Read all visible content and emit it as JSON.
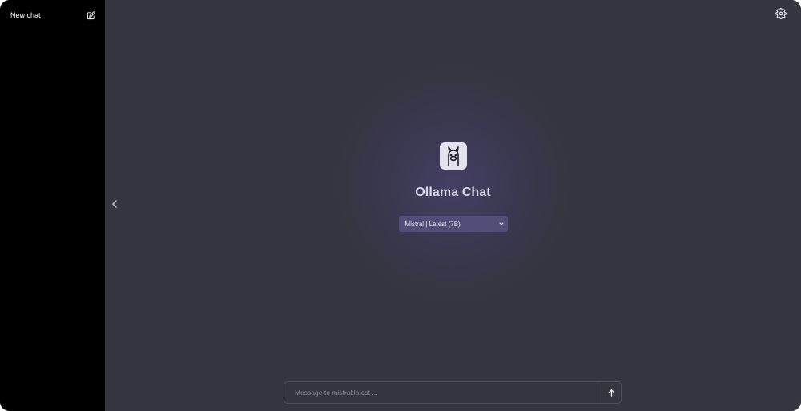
{
  "sidebar": {
    "new_chat_label": "New chat",
    "new_chat_icon": "edit-icon"
  },
  "header": {
    "settings_icon": "gear-icon"
  },
  "hero": {
    "logo_icon": "llama-icon",
    "title": "Ollama Chat",
    "model_select": {
      "selected": "Mistral | Latest (7B)",
      "icon": "chevron-down-icon"
    }
  },
  "composer": {
    "placeholder": "Message to mistral:latest ...",
    "value": "",
    "send_icon": "arrow-up-icon"
  },
  "colors": {
    "sidebar_bg": "#000000",
    "main_bg": "#35353f",
    "select_bg": "#514f77",
    "title_text": "#dad8ec"
  }
}
